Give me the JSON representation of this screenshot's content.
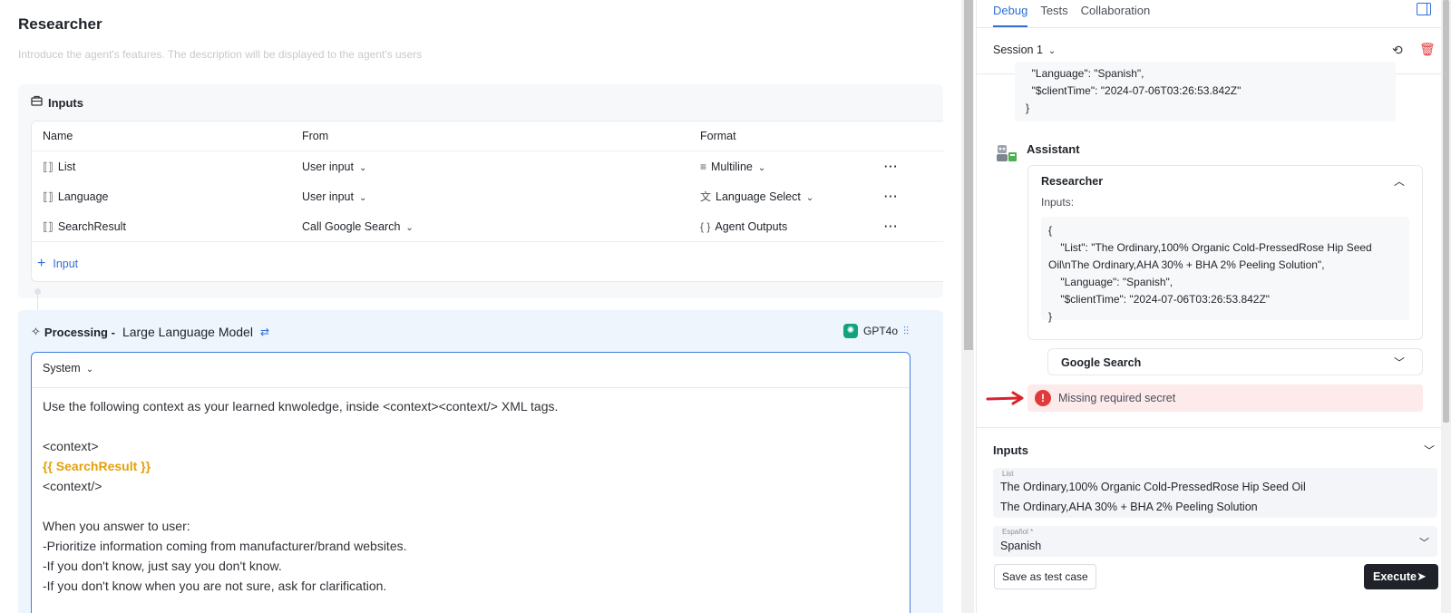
{
  "agent": {
    "title": "Researcher",
    "description_placeholder": "Introduce the agent's features. The description will be displayed to the agent's users"
  },
  "inputs": {
    "title": "Inputs",
    "columns": [
      "Name",
      "From",
      "Format"
    ],
    "rows": [
      {
        "name": "List",
        "from": "User input",
        "format": "Multiline"
      },
      {
        "name": "Language",
        "from": "User input",
        "format": "Language Select"
      },
      {
        "name": "SearchResult",
        "from": "Call Google Search",
        "format": "Agent Outputs"
      }
    ],
    "more": "···",
    "add_label": "Input"
  },
  "processing": {
    "title": "Processing -",
    "mode": "Large Language Model",
    "model": "GPT4o",
    "role": "System",
    "prompt_lines": [
      "Use the following context as your learned knwoledge, inside <context><context/> XML tags.",
      "",
      "<context>",
      "{{ SearchResult }}",
      "<context/>",
      "",
      "When you answer to user:",
      "-Prioritize information coming from manufacturer/brand websites.",
      "-If you don't know, just say you don't know.",
      "-If you don't know when you are not sure, ask for clarification."
    ]
  },
  "right_panel": {
    "tabs": [
      "Debug",
      "Tests",
      "Collaboration"
    ],
    "session": "Session 1",
    "message_lines": [
      "  \"Language\": \"Spanish\",",
      "  \"$clientTime\": \"2024-07-06T03:26:53.842Z\"",
      "}"
    ],
    "assistant_label": "Assistant",
    "card": {
      "title": "Researcher",
      "inputs_label": "Inputs:",
      "code_lines": [
        "{",
        "    \"List\": \"The Ordinary,100% Organic Cold-PressedRose Hip Seed",
        "Oil\\nThe Ordinary,AHA 30% + BHA 2% Peeling Solution\",",
        "    \"Language\": \"Spanish\",",
        "    \"$clientTime\": \"2024-07-06T03:26:53.842Z\"",
        "}"
      ]
    },
    "google_search": "Google Search",
    "error_text": "Missing required secret",
    "inputs_title": "Inputs",
    "list_label": "List",
    "list_value_1": "The Ordinary,100% Organic Cold-PressedRose Hip Seed Oil",
    "list_value_2": "The Ordinary,AHA 30% + BHA 2% Peeling Solution",
    "lang_label": "Español *",
    "lang_value": "Spanish",
    "save_test_label": "Save as test case",
    "execute_label": "Execute"
  },
  "colors": {
    "accent": "#2f6fd7",
    "error_bg": "#fdeaea",
    "error": "#e03b3b",
    "variable": "#e3a10a"
  }
}
